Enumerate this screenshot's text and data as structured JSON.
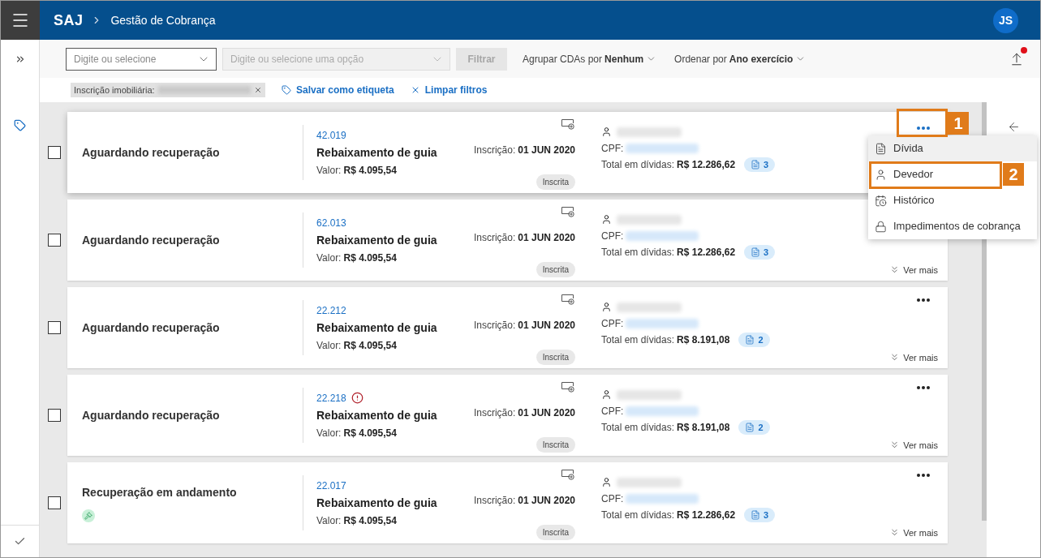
{
  "header": {
    "logo": "SAJ",
    "breadcrumb": "Gestão de Cobrança",
    "avatar": "JS"
  },
  "toolbar": {
    "field_1": {
      "placeholder": "Digite ou selecione",
      "disabled": false
    },
    "field_2": {
      "placeholder": "Digite ou selecione uma opção",
      "disabled": true
    },
    "filter_button": {
      "label": "Filtrar",
      "disabled": true
    },
    "group_by": {
      "label": "Agrupar CDAs por",
      "value": "Nenhum"
    },
    "order_by": {
      "label": "Ordenar por",
      "value": "Ano exercício"
    },
    "export_notification": true
  },
  "filters": {
    "chip_label": "Inscrição imobiliária:",
    "save_label": "Salvar como etiqueta",
    "clear_label": "Limpar filtros"
  },
  "cards": [
    {
      "checked": false,
      "highlighted": true,
      "status": "Aguardando recuperação",
      "in_progress": false,
      "number": "42.019",
      "warning": false,
      "title": "Rebaixamento de guia",
      "value_label": "Valor:",
      "value": "R$ 4.095,54",
      "date_label": "Inscrição:",
      "date": "01 JUN 2020",
      "badge": "Inscrita",
      "cpf_label": "CPF:",
      "total_label": "Total em dívidas:",
      "total": "R$ 12.286,62",
      "doc_count": "3",
      "actions_visible": true,
      "menu_open": true
    },
    {
      "checked": false,
      "highlighted": false,
      "status": "Aguardando recuperação",
      "in_progress": false,
      "number": "62.013",
      "warning": false,
      "title": "Rebaixamento de guia",
      "value_label": "Valor:",
      "value": "R$ 4.095,54",
      "date_label": "Inscrição:",
      "date": "01 JUN 2020",
      "badge": "Inscrita",
      "cpf_label": "CPF:",
      "total_label": "Total em dívidas:",
      "total": "R$ 12.286,62",
      "doc_count": "3",
      "actions_visible": false,
      "more": "Ver mais"
    },
    {
      "checked": false,
      "highlighted": false,
      "status": "Aguardando recuperação",
      "in_progress": false,
      "number": "22.212",
      "warning": false,
      "title": "Rebaixamento de guia",
      "value_label": "Valor:",
      "value": "R$ 4.095,54",
      "date_label": "Inscrição:",
      "date": "01 JUN 2020",
      "badge": "Inscrita",
      "cpf_label": "CPF:",
      "total_label": "Total em dívidas:",
      "total": "R$ 8.191,08",
      "doc_count": "2",
      "actions_visible": true,
      "menu_open": false,
      "more": "Ver mais"
    },
    {
      "checked": false,
      "highlighted": false,
      "status": "Aguardando recuperação",
      "in_progress": false,
      "number": "22.218",
      "warning": true,
      "title": "Rebaixamento de guia",
      "value_label": "Valor:",
      "value": "R$ 4.095,54",
      "date_label": "Inscrição:",
      "date": "01 JUN 2020",
      "badge": "Inscrita",
      "cpf_label": "CPF:",
      "total_label": "Total em dívidas:",
      "total": "R$ 8.191,08",
      "doc_count": "2",
      "actions_visible": true,
      "menu_open": false,
      "more": "Ver mais"
    },
    {
      "checked": false,
      "highlighted": false,
      "status": "Recuperação em andamento",
      "in_progress": true,
      "number": "22.017",
      "warning": false,
      "title": "Rebaixamento de guia",
      "value_label": "Valor:",
      "value": "R$ 4.095,54",
      "date_label": "Inscrição:",
      "date": "01 JUN 2020",
      "badge": "Inscrita",
      "cpf_label": "CPF:",
      "total_label": "Total em dívidas:",
      "total": "R$ 12.286,62",
      "doc_count": "3",
      "actions_visible": true,
      "menu_open": false,
      "more": "Ver mais"
    }
  ],
  "menu": {
    "items": [
      {
        "kind": "document",
        "label": "Dívida",
        "hovered": true
      },
      {
        "kind": "person",
        "label": "Devedor",
        "hovered": false
      },
      {
        "kind": "history",
        "label": "Histórico",
        "hovered": false
      },
      {
        "kind": "lock",
        "label": "Impedimentos de cobrança",
        "hovered": false
      }
    ]
  },
  "annotations": [
    {
      "label": "1"
    },
    {
      "label": "2"
    }
  ]
}
